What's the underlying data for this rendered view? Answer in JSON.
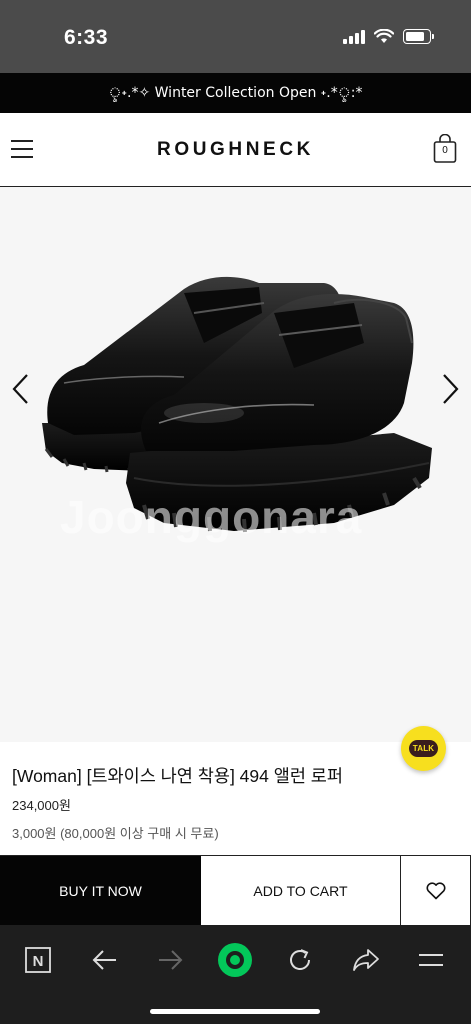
{
  "status_bar": {
    "time": "6:33"
  },
  "announcement": {
    "text": "ৢ˖.*✧ Winter Collection Open ˖.*ৢ:*"
  },
  "header": {
    "brand": "ROUGHNECK",
    "cart_count": "0"
  },
  "hero": {
    "watermark": "Joonggonara"
  },
  "kakao": {
    "label": "TALK"
  },
  "product": {
    "name": "[Woman] [트와이스 나연 착용] 494 앨런 로퍼",
    "price": "234,000원",
    "shipping": "3,000원 (80,000원 이상 구매 시 무료)"
  },
  "actions": {
    "buy_now": "BUY IT NOW",
    "add_to_cart": "ADD TO CART"
  },
  "browser_bar": {
    "n_label": "N"
  },
  "colors": {
    "status_bar": "#4b4b4b",
    "announcement_bg": "#050505",
    "buy_button": "#050505",
    "kakao_yellow": "#f7df1e",
    "browser_accent": "#03c75a",
    "browser_bar": "#1e1e1e"
  }
}
